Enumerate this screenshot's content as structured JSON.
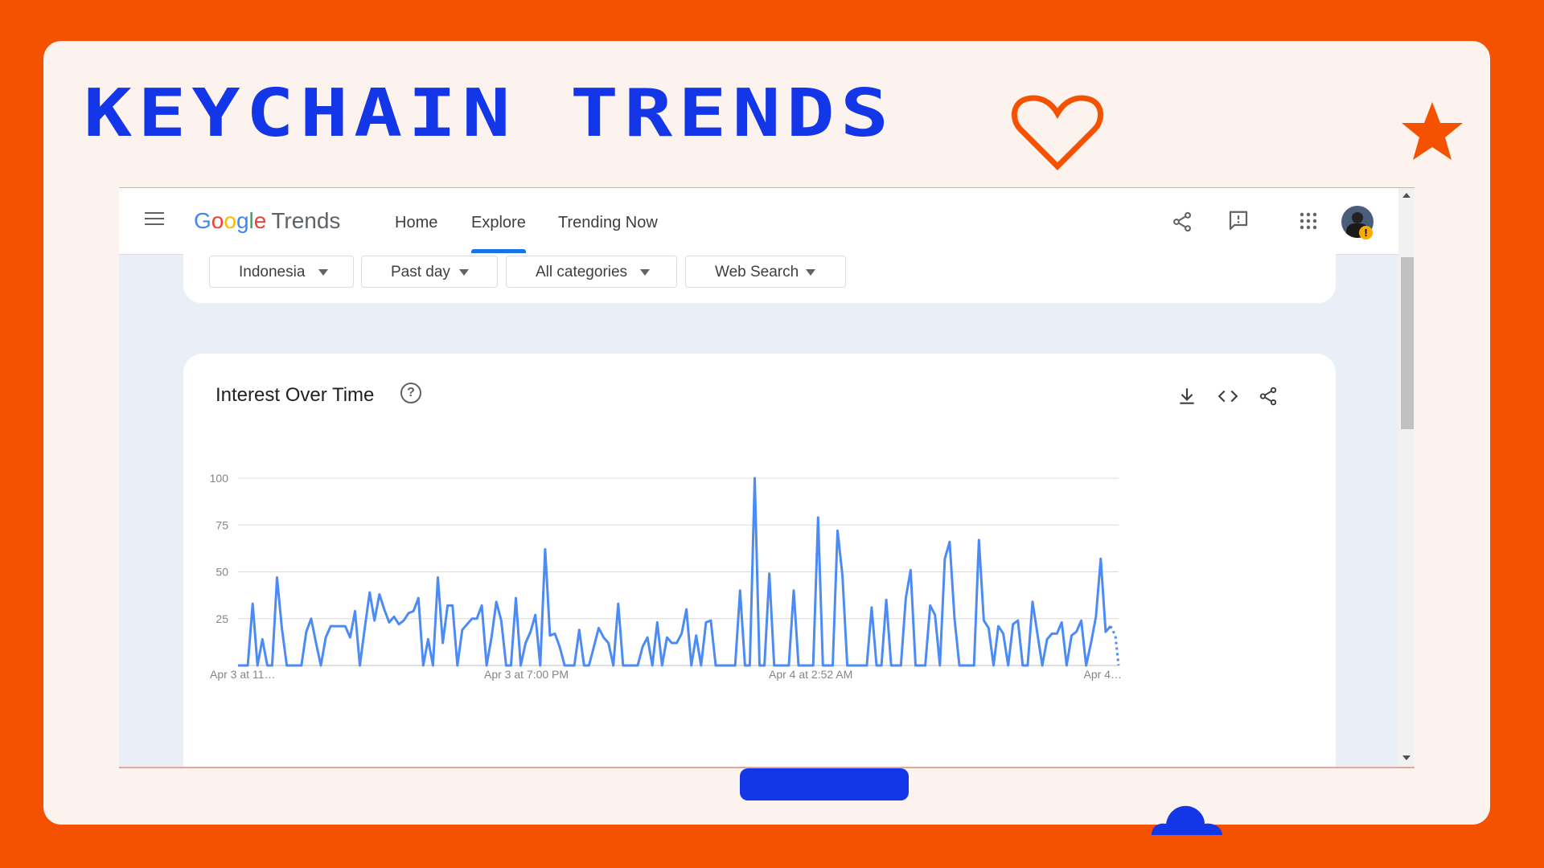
{
  "page": {
    "title": "KEYCHAIN TRENDS"
  },
  "decor": {
    "heart": "heart-icon",
    "star": "star-icon",
    "cloud": "cloud-icon"
  },
  "colors": {
    "background": "#f45200",
    "card": "#fdf3ee",
    "title": "#1236e8",
    "accent": "#f45200",
    "line": "#4c8bf5"
  },
  "app": {
    "name_parts": [
      "G",
      "o",
      "o",
      "g",
      "l",
      "e"
    ],
    "name_suffix": "Trends",
    "nav": [
      "Home",
      "Explore",
      "Trending Now"
    ],
    "active_nav": "Explore",
    "top_icons": [
      "share-icon",
      "feedback-icon",
      "apps-grid-icon",
      "account-avatar"
    ],
    "warning_badge": "!"
  },
  "filters": [
    {
      "label": "Indonesia"
    },
    {
      "label": "Past day"
    },
    {
      "label": "All categories"
    },
    {
      "label": "Web Search"
    }
  ],
  "chart_panel": {
    "title": "Interest Over Time",
    "help_icon": "?",
    "actions": [
      "download-icon",
      "embed-code-icon",
      "share-icon"
    ]
  },
  "chart_data": {
    "type": "line",
    "title": "Interest Over Time",
    "ylim": [
      0,
      100
    ],
    "y_ticks": [
      "100",
      "75",
      "50",
      "25"
    ],
    "x_ticks": [
      "Apr 3 at 11…",
      "Apr 3 at 7:00 PM",
      "Apr 4 at 2:52 AM",
      "Apr 4…"
    ],
    "grid": true,
    "series": [
      {
        "values": [
          0,
          0,
          0,
          33,
          0,
          14,
          0,
          0,
          47,
          20,
          0,
          0,
          0,
          0,
          18,
          25,
          12,
          0,
          15,
          21,
          21,
          21,
          21,
          15,
          29,
          0,
          20,
          39,
          24,
          38,
          30,
          23,
          26,
          22,
          24,
          28,
          29,
          36,
          0,
          14,
          0,
          47,
          12,
          32,
          32,
          0,
          19,
          22,
          25,
          25,
          32,
          0,
          15,
          34,
          24,
          0,
          0,
          36,
          0,
          12,
          18,
          27,
          0,
          62,
          16,
          17,
          10,
          0,
          0,
          0,
          19,
          0,
          0,
          10,
          20,
          15,
          12,
          0,
          33,
          0,
          0,
          0,
          0,
          10,
          15,
          0,
          23,
          0,
          15,
          12,
          12,
          17,
          30,
          0,
          16,
          0,
          23,
          24,
          0,
          0,
          0,
          0,
          0,
          40,
          0,
          0,
          100,
          0,
          0,
          49,
          0,
          0,
          0,
          0,
          40,
          0,
          0,
          0,
          0,
          79,
          0,
          0,
          0,
          72,
          48,
          0,
          0,
          0,
          0,
          0,
          31,
          0,
          0,
          35,
          0,
          0,
          0,
          36,
          51,
          0,
          0,
          0,
          32,
          27,
          0,
          57,
          66,
          25,
          0,
          0,
          0,
          0,
          67,
          24,
          20,
          0,
          21,
          17,
          0,
          22,
          24,
          0,
          0,
          34,
          17,
          0,
          14,
          17,
          17,
          23,
          0,
          16,
          18,
          24,
          0,
          12,
          26,
          57,
          18,
          21,
          16
        ],
        "partial_tail": true
      }
    ]
  }
}
